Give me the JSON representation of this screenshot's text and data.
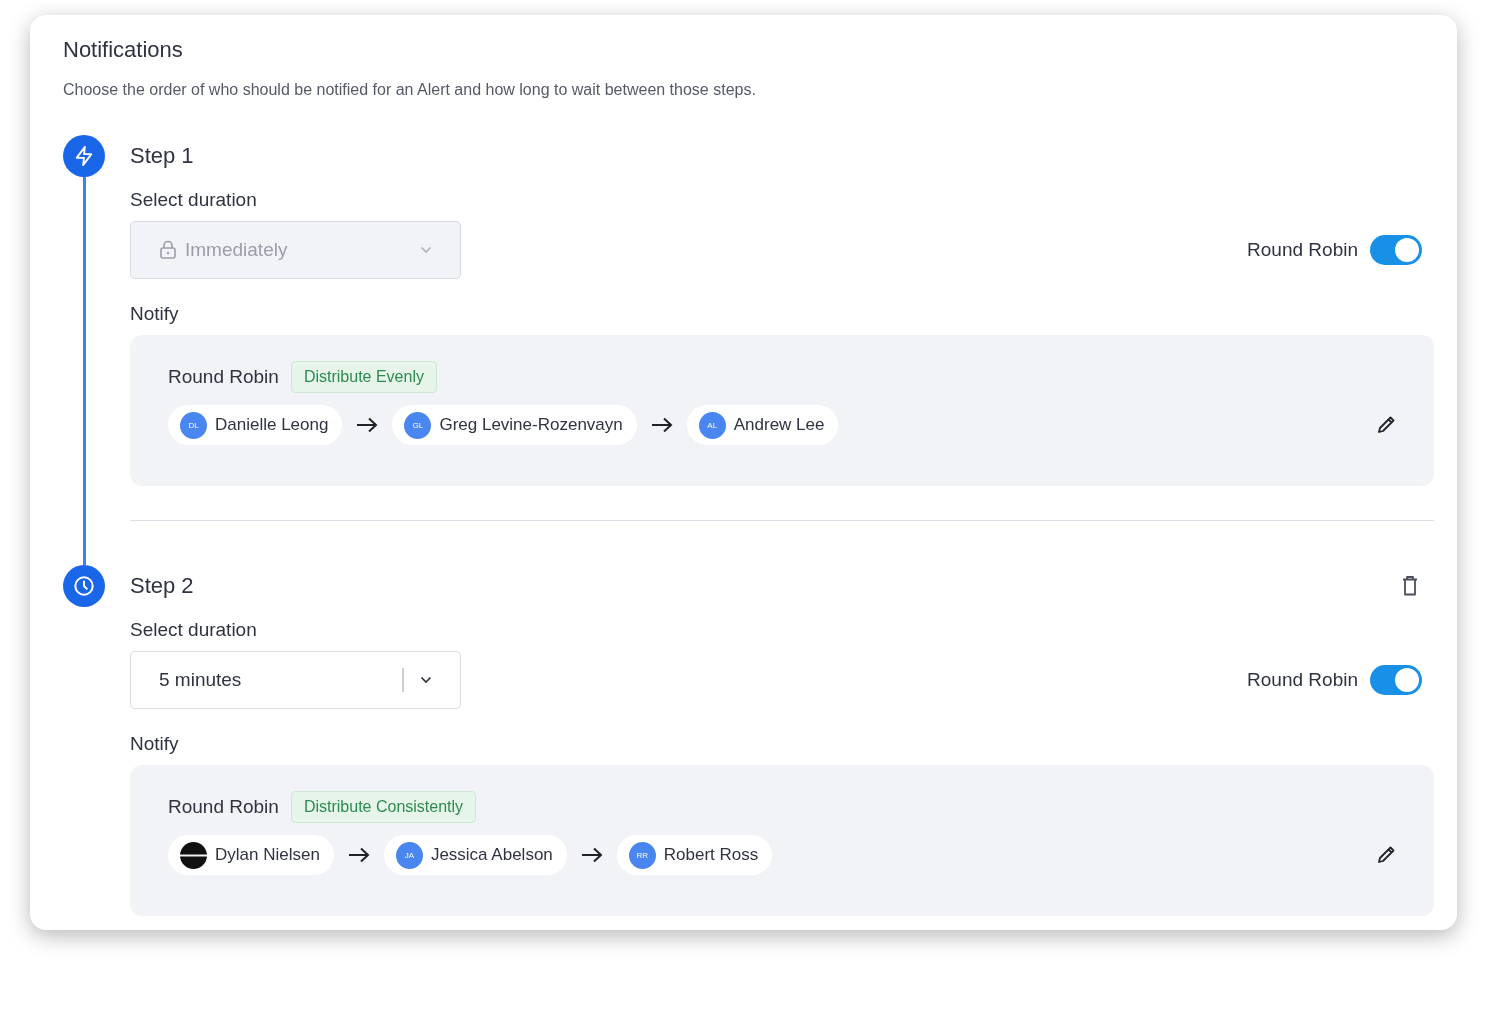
{
  "title": "Notifications",
  "description": "Choose the order of who should be notified for an Alert and how long to wait between those steps.",
  "steps": [
    {
      "kind": "bolt",
      "title": "Step 1",
      "deletable": false,
      "duration_label": "Select duration",
      "duration": {
        "value": "Immediately",
        "disabled": true
      },
      "toggle": {
        "label": "Round Robin",
        "on": true
      },
      "notify_label": "Notify",
      "group": {
        "label": "Round Robin",
        "tag": "Distribute Evenly",
        "people": [
          {
            "kind": "initials",
            "initials": "DL",
            "name": "Danielle Leong"
          },
          {
            "kind": "initials",
            "initials": "GL",
            "name": "Greg Levine-Rozenvayn"
          },
          {
            "kind": "initials",
            "initials": "AL",
            "name": "Andrew Lee"
          }
        ]
      }
    },
    {
      "kind": "clock",
      "title": "Step 2",
      "deletable": true,
      "duration_label": "Select duration",
      "duration": {
        "value": "5 minutes",
        "disabled": false
      },
      "toggle": {
        "label": "Round Robin",
        "on": true
      },
      "notify_label": "Notify",
      "group": {
        "label": "Round Robin",
        "tag": "Distribute Consistently",
        "people": [
          {
            "kind": "image",
            "name": "Dylan Nielsen"
          },
          {
            "kind": "initials",
            "initials": "JA",
            "name": "Jessica Abelson"
          },
          {
            "kind": "initials",
            "initials": "RR",
            "name": "Robert Ross"
          }
        ]
      }
    }
  ]
}
